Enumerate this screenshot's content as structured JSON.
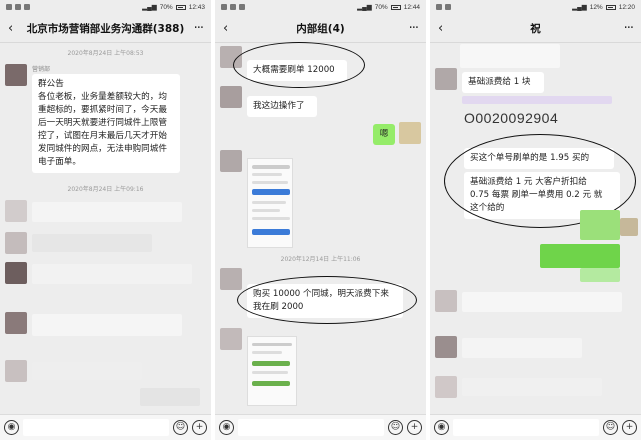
{
  "status": {
    "time1": "12:43",
    "time2": "12:44",
    "time3": "12:20",
    "batt1": "70%",
    "batt2": "70%",
    "batt3": "12%"
  },
  "panel1": {
    "title": "北京市场营销部业务沟通群(388)",
    "ts1": "2020年8月24日 上午08:53",
    "sender": "营销部",
    "msg_lines": [
      "群公告",
      "各位老板，业务量差额较大的，均",
      "重超标的，要抓紧时间了，今天最",
      "后一天明天就要进行同城件上限管",
      "控了，试图在月末最后几天才开始",
      "发同城件的网点，无法申购同城件",
      "电子面单。"
    ],
    "ts2": "2020年8月24日 上午09:16"
  },
  "panel2": {
    "title": "内部组(4)",
    "msg1": "大概需要刷单 12000",
    "msg2": "我这边操作了",
    "msg3": "嗯",
    "ts": "2020年12月14日 上午11:06",
    "msg4_lines": [
      "购买 10000 个同城，明天派费下来",
      "我在刷 2000"
    ]
  },
  "panel3": {
    "title": "祝",
    "msg1": "基础派费给 1 块",
    "code": "O0020092904",
    "msg2": "买这个单号刷单的是 1.95 买的",
    "msg3_lines": [
      "基础派费给 1 元 大客户折扣给",
      "0.75 每票  刷单一单费用 0.2 元  就",
      "这个给的"
    ]
  },
  "icons": {
    "back": "‹",
    "more": "···",
    "voice": "◉",
    "emoji": "☺",
    "plus": "+"
  }
}
